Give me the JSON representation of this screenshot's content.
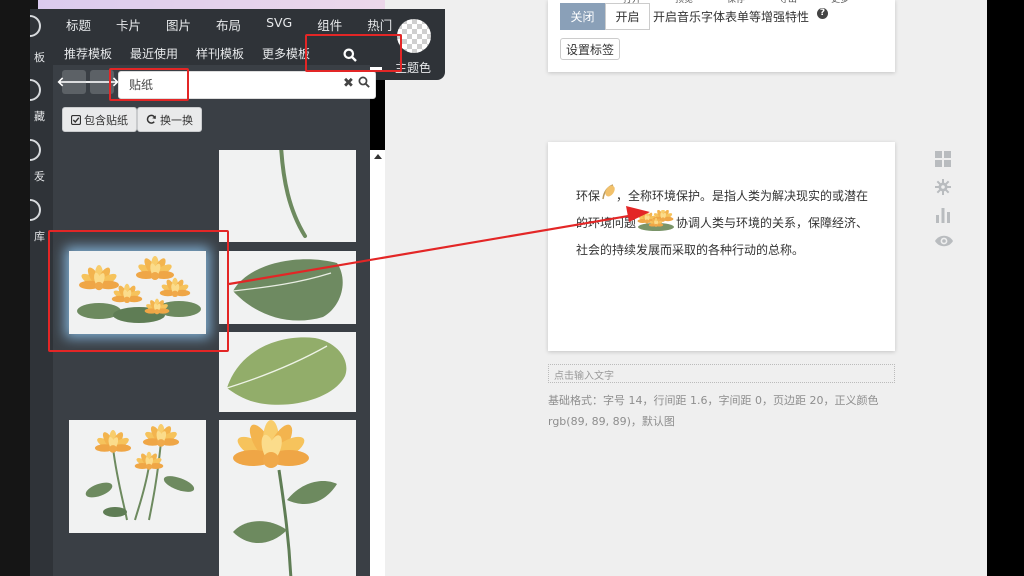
{
  "top_toolbar": {
    "items": [
      "打开",
      "预览",
      "保存",
      "导出",
      "更多"
    ]
  },
  "left_nav": {
    "items": [
      "板",
      "藏",
      "叐",
      "库"
    ]
  },
  "nav": {
    "row1": [
      "标题",
      "卡片",
      "图片",
      "布局",
      "SVG",
      "组件",
      "热门"
    ],
    "row2": [
      "推荐模板",
      "最近使用",
      "样刊模板",
      "更多模板"
    ],
    "theme_label": "主题色"
  },
  "search": {
    "value": "贴纸",
    "tag_label": "包含贴纸",
    "refresh_label": "换一换"
  },
  "settings_card": {
    "toggle_off": "关闭",
    "toggle_on": "开启",
    "description": "开启音乐字体表单等增强特性",
    "label_button": "设置标签"
  },
  "article": {
    "part1": "环保",
    "part2": "，全称环境保护。是指人类为解决现实的或潜在的环境问题",
    "part3": "协调人类与环境的关系，保障经济、社会的持续发展而采取的各种行动的总称。"
  },
  "editor": {
    "hint": "点击输入文字",
    "info": "基础格式：字号 14，行间距 1.6，字间距 0，页边距 20，正义颜色 rgb(89, 89, 89)，默认图"
  },
  "colors": {
    "highlight_red": "#e32626",
    "panel_dark": "#2f3338",
    "leaf_green": "#6d8a5f",
    "petal_yellow": "#f4bf5a"
  }
}
